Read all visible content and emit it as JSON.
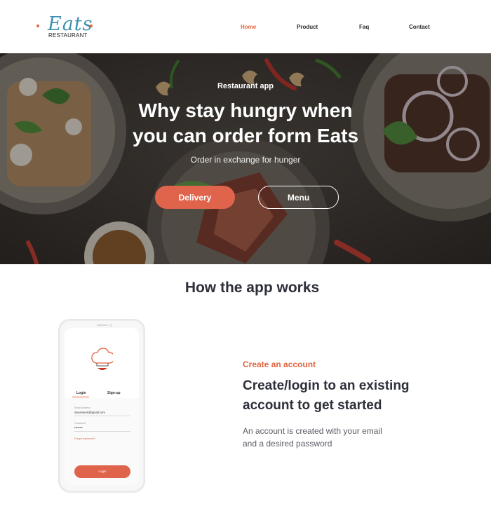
{
  "logo": {
    "wordmark": "Eats",
    "subtitle": "RESTAURANT"
  },
  "nav": {
    "items": [
      {
        "label": "Home",
        "active": true
      },
      {
        "label": "Product",
        "active": false
      },
      {
        "label": "Faq",
        "active": false
      },
      {
        "label": "Contact",
        "active": false
      }
    ]
  },
  "hero": {
    "kicker": "Restaurant app",
    "title_line1": "Why stay hungry when",
    "title_line2": "you can order form Eats",
    "subtitle": "Order in exchange for hunger",
    "primary_button": "Delivery",
    "secondary_button": "Menu"
  },
  "how": {
    "title": "How the app works"
  },
  "phone": {
    "tabs": [
      "Login",
      "Sign-up"
    ],
    "email_label": "Email address",
    "email_value": "Sesamevis@gmail.com",
    "password_label": "Password",
    "password_value": "••••••••",
    "forgot": "Forgot password?",
    "login_button": "Login"
  },
  "step": {
    "kicker": "Create an account",
    "title_line1": "Create/login to an existing",
    "title_line2": "account to get started",
    "desc_line1": "An account is created with your email",
    "desc_line2": "and a desired password"
  },
  "colors": {
    "accent": "#e0643f",
    "button": "#e0634c",
    "logo": "#3f8fb2",
    "heading": "#2d2f3a"
  },
  "icons": [
    "chef-hat-icon"
  ]
}
